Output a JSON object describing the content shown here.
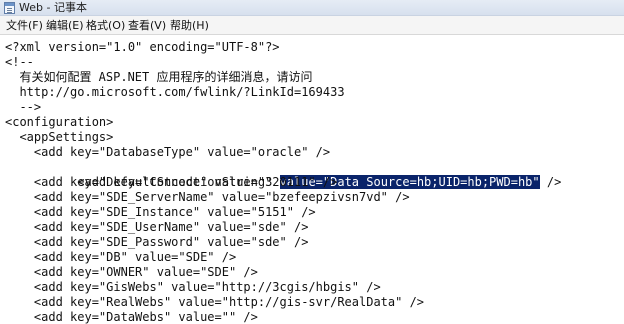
{
  "window": {
    "title": "Web - 记事本"
  },
  "menu": {
    "items": [
      "文件(F)",
      "编辑(E)",
      "格式(O)",
      "查看(V)",
      "帮助(H)"
    ]
  },
  "editor": {
    "lines": [
      "<?xml version=\"1.0\" encoding=\"UTF-8\"?>",
      "<!--",
      "  有关如何配置 ASP.NET 应用程序的详细消息，请访问",
      "  http://go.microsoft.com/fwlink/?LinkId=169433",
      "  -->",
      "<configuration>",
      "  <appSettings>",
      "    <add key=\"DatabaseType\" value=\"oracle\" />",
      "    <add key=\"ConnectionString\" ",
      "    <add key=\"DefaultStcode\" value=\"320111\" />",
      "    <add key=\"SDE_ServerName\" value=\"bzefeepzivsn7vd\" />",
      "    <add key=\"SDE_Instance\" value=\"5151\" />",
      "    <add key=\"SDE_UserName\" value=\"sde\" />",
      "    <add key=\"SDE_Password\" value=\"sde\" />",
      "    <add key=\"DB\" value=\"SDE\" />",
      "    <add key=\"OWNER\" value=\"SDE\" />",
      "    <add key=\"GisWebs\" value=\"http://3cgis/hbgis\" />",
      "    <add key=\"RealWebs\" value=\"http://gis-svr/RealData\" />",
      "    <add key=\"DataWebs\" value=\"\" />"
    ],
    "selected_text": "value=\"Data Source=hb;UID=hb;PWD=hb\"",
    "line_suffix": " />"
  }
}
